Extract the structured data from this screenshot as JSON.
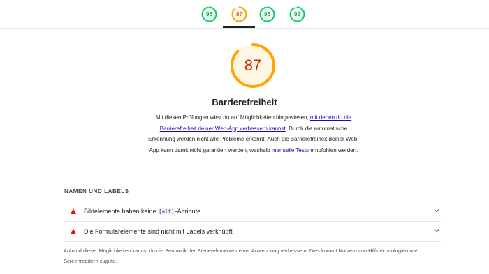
{
  "colors": {
    "pass": "#0cce6b",
    "average": "#ffa400",
    "fail": "#eb0f00"
  },
  "tabs": [
    {
      "score": "96",
      "rating": "pass"
    },
    {
      "score": "87",
      "rating": "average",
      "selected": true
    },
    {
      "score": "96",
      "rating": "pass"
    },
    {
      "score": "92",
      "rating": "pass"
    }
  ],
  "category": {
    "score": "87",
    "score_fraction": 0.87,
    "title": "Barrierefreiheit",
    "desc_part1": "Mit diesen Prüfungen wirst du auf Möglichkeiten hingewiesen, ",
    "desc_link1": "mit denen du die Barrierefreiheit deiner Web-App verbessern kannst",
    "desc_part2": ". Durch die automatische Erkennung werden nicht alle Probleme erkannt. Auch die Barrierefreiheit deiner Web-App kann damit nicht garantiert werden, weshalb ",
    "desc_link2": "manuelle Tests",
    "desc_part3": " empfohlen werden."
  },
  "group": {
    "title": "NAMEN UND LABELS",
    "audits": [
      {
        "label_pre": "Bildelemente haben keine ",
        "code": "[alt]",
        "label_post": "-Attribute",
        "icon": "fail-triangle-icon"
      },
      {
        "label_pre": "Die Formularelemente sind nicht mit Labels verknüpft",
        "code": "",
        "label_post": "",
        "icon": "fail-triangle-icon"
      }
    ],
    "footer": "Anhand dieser Möglichkeiten kannst du die Semantik der Steuerelemente deiner Anwendung verbessern. Dies kommt Nutzern von Hilfstechnologien wie Screenreadern zugute."
  }
}
